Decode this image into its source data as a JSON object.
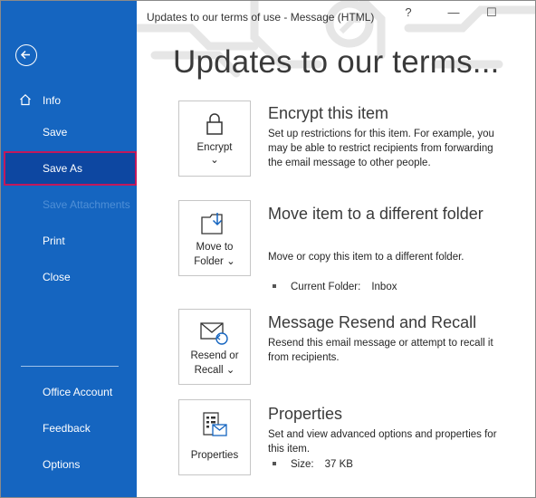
{
  "window": {
    "title": "Updates to our terms of use  -  Message (HTML)",
    "help_label": "?",
    "minimize_label": "—",
    "maximize_label": "☐"
  },
  "sidebar": {
    "info_label": "Info",
    "items": [
      {
        "label": "Save",
        "state": "normal"
      },
      {
        "label": "Save As",
        "state": "selected"
      },
      {
        "label": "Save Attachments",
        "state": "disabled"
      },
      {
        "label": "Print",
        "state": "normal"
      },
      {
        "label": "Close",
        "state": "normal"
      }
    ],
    "bottom_items": [
      {
        "label": "Office Account"
      },
      {
        "label": "Feedback"
      },
      {
        "label": "Options"
      }
    ]
  },
  "main": {
    "page_title": "Updates to our terms...",
    "sections": [
      {
        "button_label": "Encrypt",
        "button_sub": "⌄",
        "title": "Encrypt this item",
        "description": "Set up restrictions for this item. For example, you may be able to restrict recipients from forwarding the email message to other people."
      },
      {
        "button_label": "Move to",
        "button_sub": "Folder ⌄",
        "title": "Move item to a different folder",
        "description": "Move or copy this item to a different folder.",
        "detail_label": "Current Folder:",
        "detail_value": "Inbox"
      },
      {
        "button_label": "Resend or",
        "button_sub": "Recall ⌄",
        "title": "Message Resend and Recall",
        "description": "Resend this email message or attempt to recall it from recipients."
      },
      {
        "button_label": "Properties",
        "title": "Properties",
        "description": "Set and view advanced options and properties for this item.",
        "detail_label": "Size:",
        "detail_value": "37 KB"
      }
    ]
  },
  "colors": {
    "sidebar_bg": "#1565c0",
    "selected_bg": "#0d47a1",
    "selected_border": "#c2185b",
    "disabled_text": "#4f8fd6"
  }
}
